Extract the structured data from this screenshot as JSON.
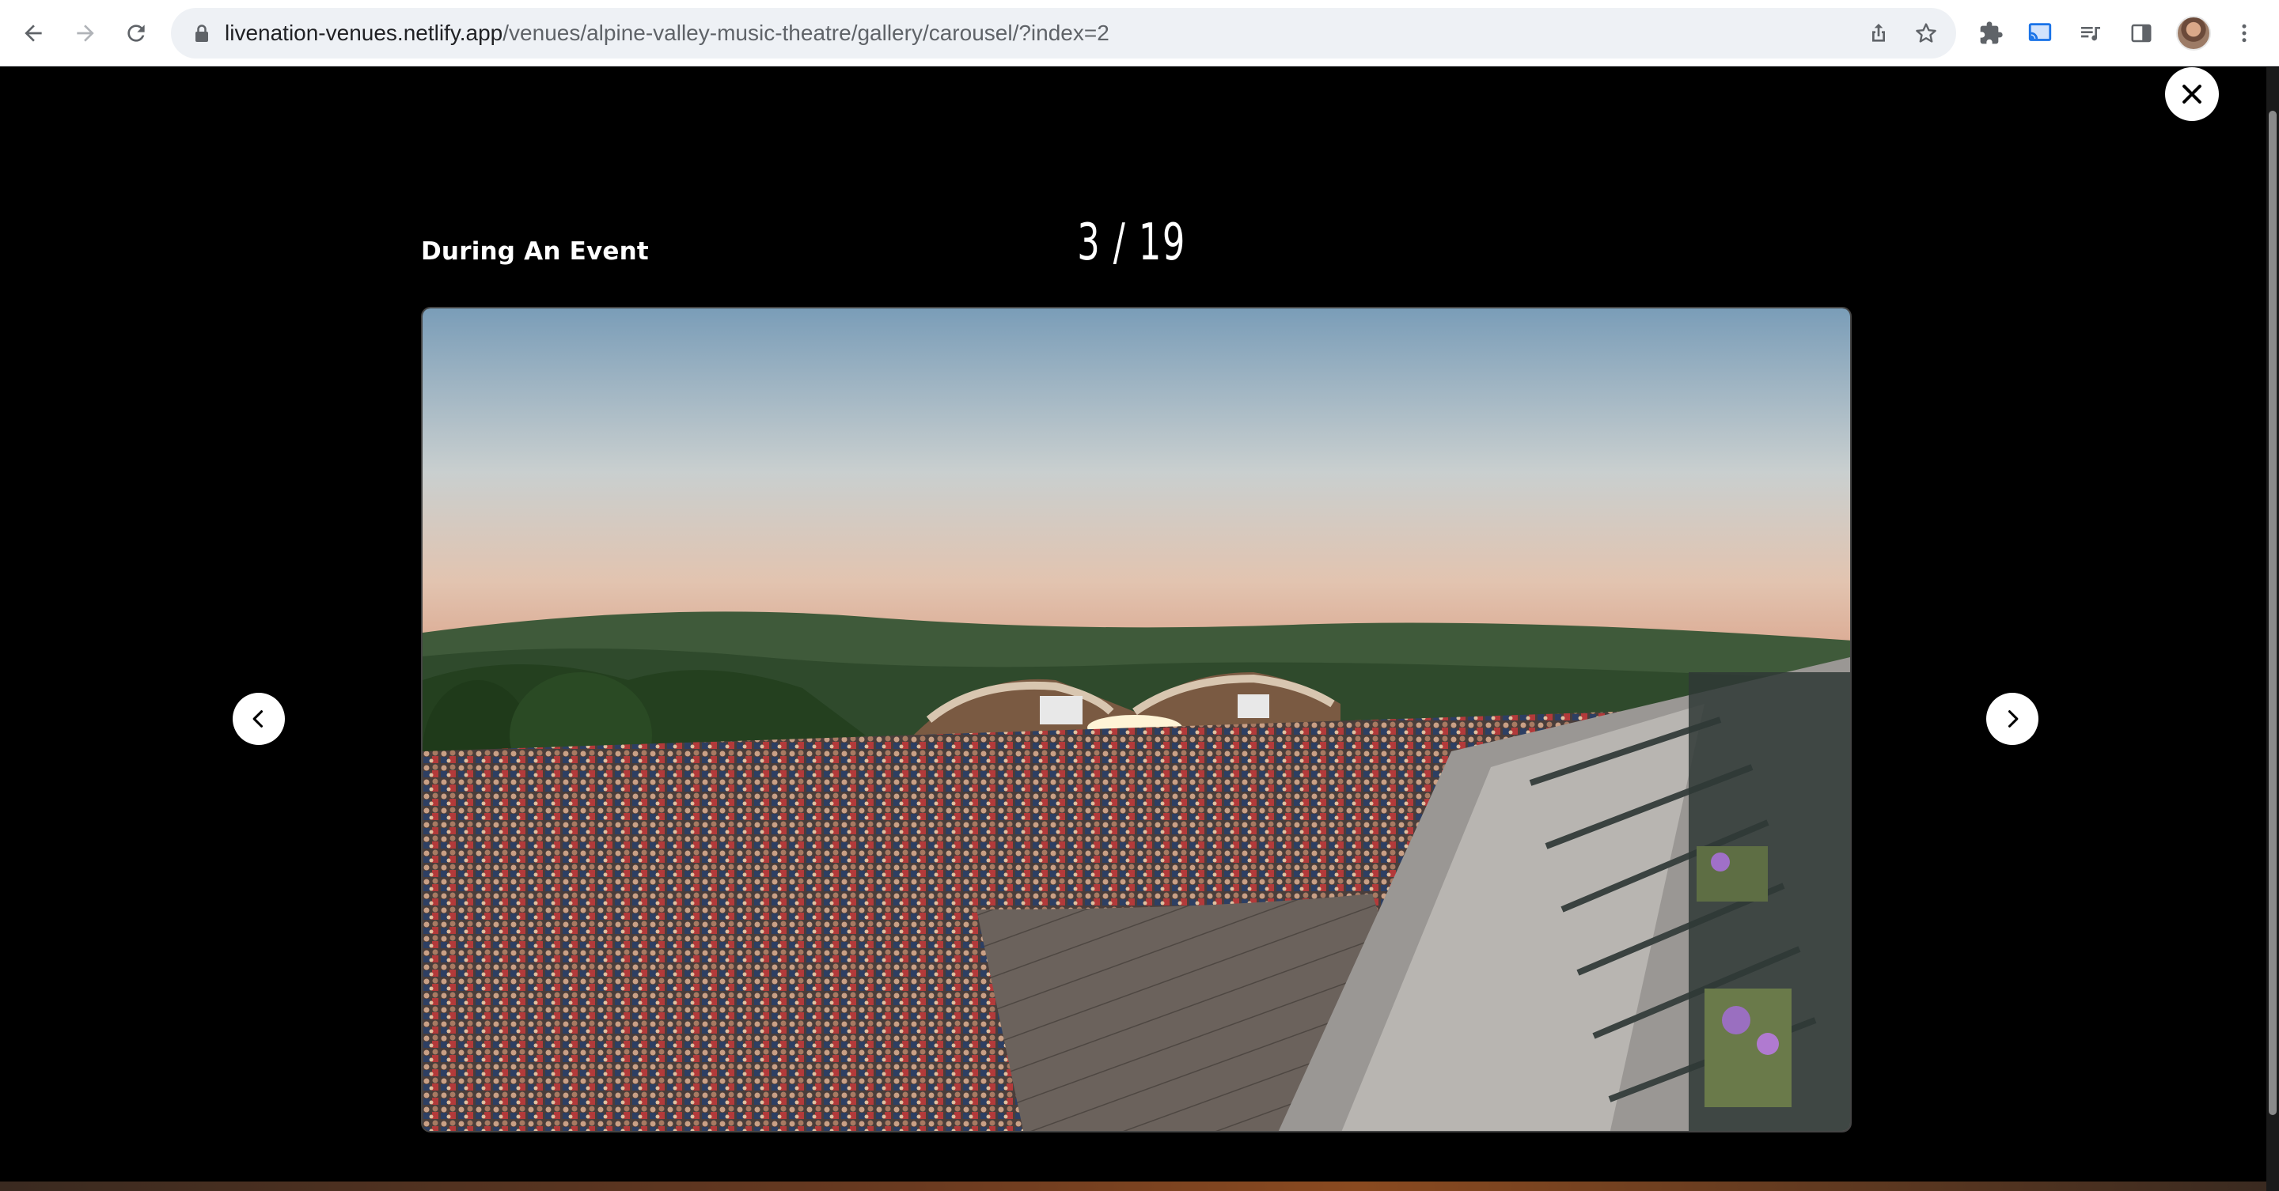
{
  "browser": {
    "url_host": "livenation-venues.netlify.app",
    "url_path": "/venues/alpine-valley-music-theatre/gallery/carousel/?index=2"
  },
  "gallery": {
    "title": "During An Event",
    "counter": "3 / 19",
    "current_index": 3,
    "total": 19,
    "photo_alt": "Crowd at Alpine Valley Music Theatre at sunset"
  },
  "icons": {
    "back": "arrow-left-icon",
    "forward": "arrow-right-icon",
    "reload": "reload-icon",
    "lock": "lock-icon",
    "share": "share-icon",
    "bookmark": "star-icon",
    "extensions": "puzzle-icon",
    "cast": "cast-icon",
    "media": "media-queue-icon",
    "sidepanel": "side-panel-icon",
    "menu": "kebab-menu-icon",
    "close": "close-icon",
    "prev": "chevron-left-icon",
    "next": "chevron-right-icon"
  },
  "colors": {
    "background": "#000000",
    "chrome": "#ffffff",
    "omnibox": "#eef1f5",
    "cast_active": "#1a73e8"
  }
}
